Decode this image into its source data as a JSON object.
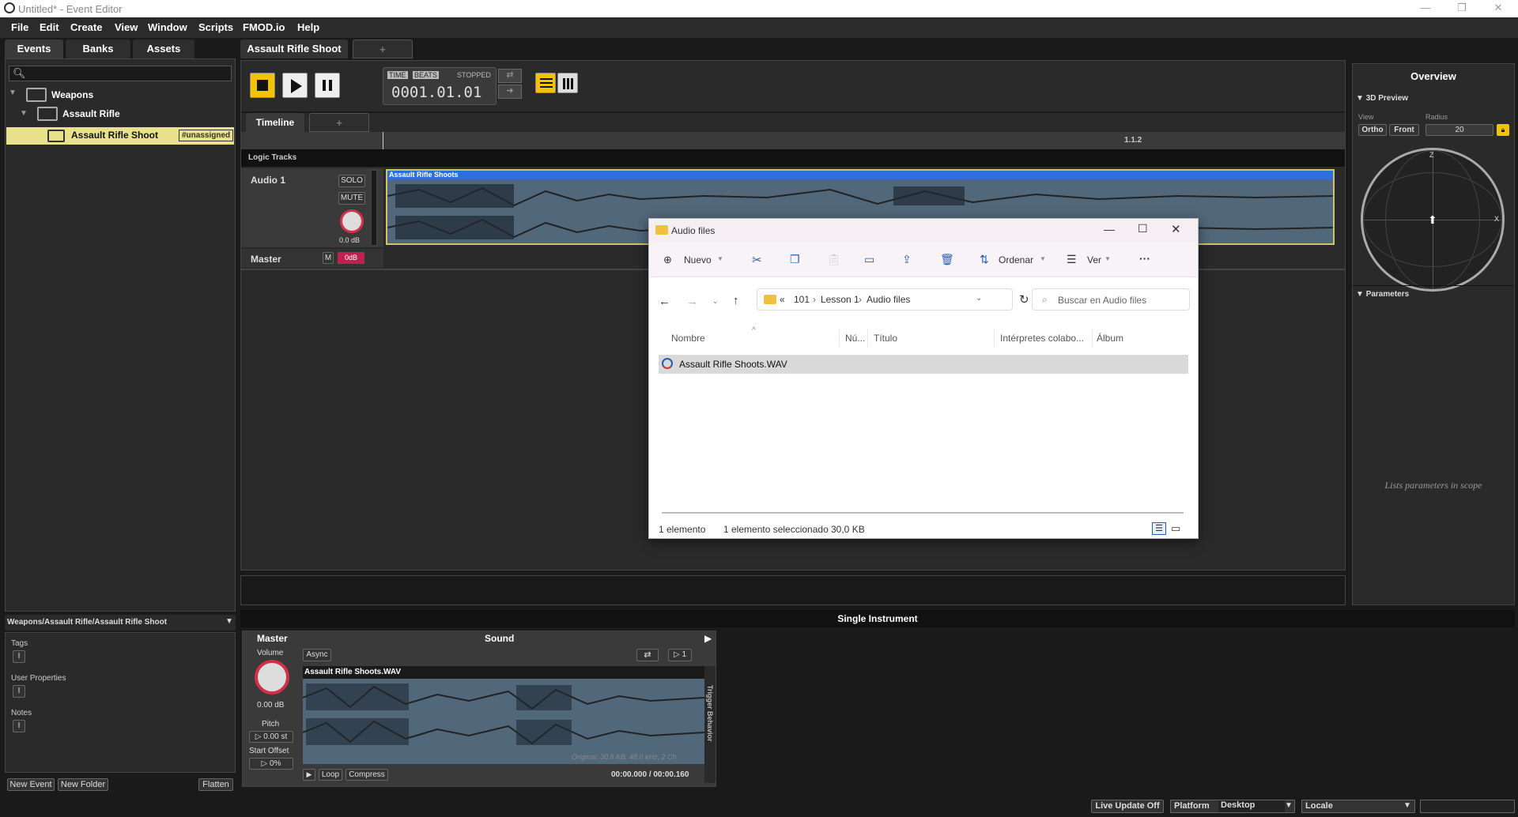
{
  "window": {
    "title": "Untitled* - Event Editor"
  },
  "menu": [
    "File",
    "Edit",
    "Create",
    "View",
    "Window",
    "Scripts",
    "FMOD.io",
    "Help"
  ],
  "left_tabs": [
    "Events",
    "Banks",
    "Assets"
  ],
  "tree": {
    "folder1": "Weapons",
    "folder2": "Assault Rifle",
    "event": "Assault Rifle Shoot",
    "badge": "#unassigned"
  },
  "path": "Weapons/Assault Rifle/Assault Rifle Shoot",
  "props": {
    "tags": "Tags",
    "user_properties": "User Properties",
    "notes": "Notes"
  },
  "bottom_left": {
    "new_event": "New Event",
    "new_folder": "New Folder",
    "flatten": "Flatten"
  },
  "editor_tab": "Assault Rifle Shoot",
  "editor_tab_add": "+",
  "transport": {
    "time": "TIME",
    "beats": "BEATS",
    "state": "STOPPED",
    "position": "0001.01.01"
  },
  "timeline": {
    "tab": "Timeline",
    "add": "+",
    "marker": "1.1.2",
    "logic_tracks": "Logic Tracks"
  },
  "track": {
    "name": "Audio 1",
    "solo": "SOLO",
    "mute": "MUTE",
    "volume": "0.0 dB",
    "region": "Assault Rifle Shoots"
  },
  "master": {
    "name": "Master",
    "m": "M",
    "level": "0dB"
  },
  "overview": {
    "title": "Overview",
    "preview": "3D Preview",
    "view": "View",
    "ortho": "Ortho",
    "front": "Front",
    "radius": "Radius",
    "radius_val": "20",
    "z": "Z",
    "x": "X",
    "parameters": "Parameters",
    "params_empty": "Lists parameters in scope"
  },
  "instrument": {
    "header": "Single Instrument",
    "master": "Master",
    "sound": "Sound",
    "volume": "Volume",
    "volume_val": "0.00 dB",
    "pitch": "Pitch",
    "pitch_val": "0.00 st",
    "start_offset": "Start Offset",
    "offset_val": "0%",
    "async": "Async",
    "loop_count": "1",
    "file": "Assault Rifle Shoots.WAV",
    "file_info": "Original: 30.8 KB, 48.0 kHz, 2 Ch",
    "loop": "Loop",
    "compress": "Compress",
    "time": "00:00.000 / 00:00.160",
    "trigger": "Trigger Behavior"
  },
  "status": {
    "live": "Live Update Off",
    "platform": "Platform",
    "platform_val": "Desktop",
    "locale": "Locale"
  },
  "explorer": {
    "title": "Audio files",
    "nuevo": "Nuevo",
    "ordenar": "Ordenar",
    "ver": "Ver",
    "more": "···",
    "crumbs": [
      "«",
      "101",
      "Lesson 1",
      "Audio files"
    ],
    "search": "Buscar en Audio files",
    "cols": [
      "Nombre",
      "Nú...",
      "Título",
      "Intérpretes colabo...",
      "Álbum"
    ],
    "file": "Assault Rifle Shoots.WAV",
    "status": {
      "count": "1 elemento",
      "selected": "1 elemento seleccionado",
      "size": "30,0 KB"
    }
  }
}
